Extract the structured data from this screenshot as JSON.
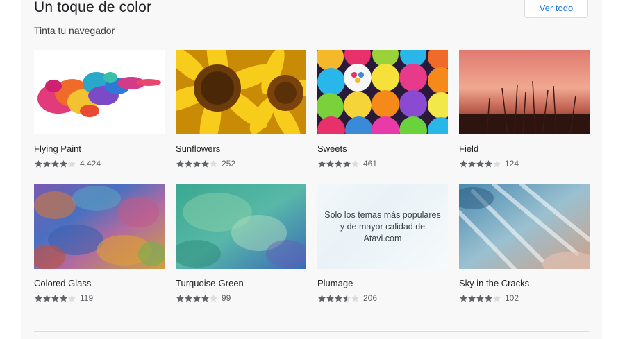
{
  "section": {
    "title": "Un toque de color",
    "subtitle": "Tinta tu navegador",
    "view_all_label": "Ver todo"
  },
  "themes": [
    {
      "name": "Flying Paint",
      "stars": 4,
      "count": "4.424"
    },
    {
      "name": "Sunflowers",
      "stars": 4,
      "count": "252"
    },
    {
      "name": "Sweets",
      "stars": 4,
      "count": "461"
    },
    {
      "name": "Field",
      "stars": 4,
      "count": "124"
    },
    {
      "name": "Colored Glass",
      "stars": 4,
      "count": "119"
    },
    {
      "name": "Turquoise-Green",
      "stars": 4,
      "count": "99"
    },
    {
      "name": "Plumage",
      "stars": 3.5,
      "count": "206",
      "overlay_text": "Solo los temas más populares y de mayor calidad de Atavi.com"
    },
    {
      "name": "Sky in the Cracks",
      "stars": 4,
      "count": "102"
    }
  ],
  "colors": {
    "star_filled": "#5f6368",
    "star_empty": "#dadce0",
    "accent": "#1a73e8"
  }
}
